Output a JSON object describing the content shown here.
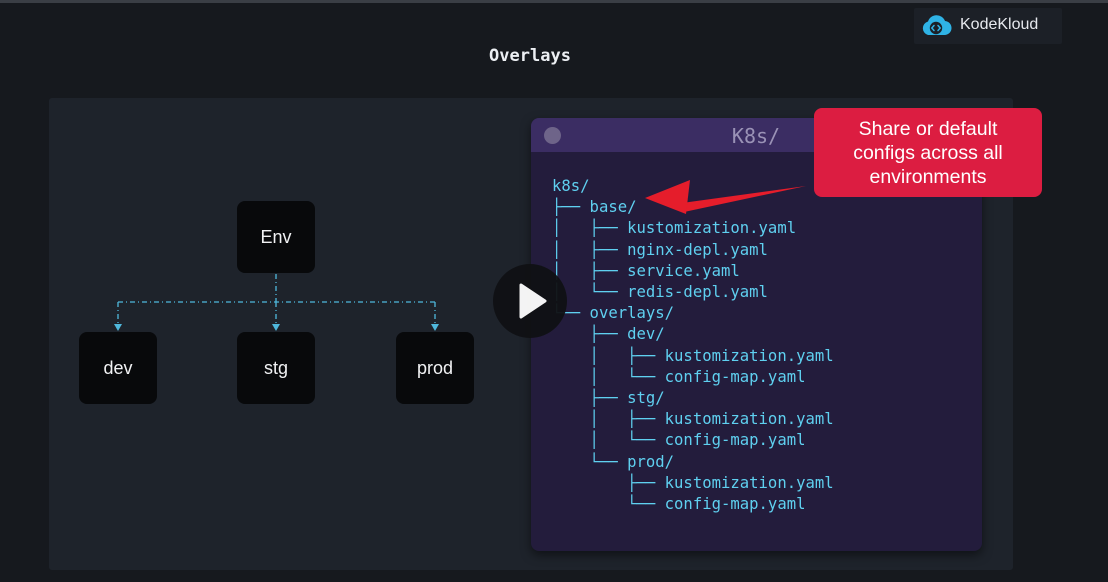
{
  "brand": {
    "name": "KodeKloud",
    "logo_icon": "cloud-code-logo-icon"
  },
  "page": {
    "title": "Overlays"
  },
  "diagram": {
    "root": "Env",
    "children": [
      "dev",
      "stg",
      "prod"
    ]
  },
  "terminal": {
    "title": "K8s/",
    "lines": [
      "k8s/",
      "├── base/",
      "│   ├── kustomization.yaml",
      "│   ├── nginx-depl.yaml",
      "│   ├── service.yaml",
      "│   └── redis-depl.yaml",
      "└── overlays/",
      "    ├── dev/",
      "    │   ├── kustomization.yaml",
      "    │   └── config-map.yaml",
      "    ├── stg/",
      "    │   ├── kustomization.yaml",
      "    │   └── config-map.yaml",
      "    └── prod/",
      "        ├── kustomization.yaml",
      "        └── config-map.yaml"
    ]
  },
  "callout": {
    "text": "Share or default configs across all environments"
  },
  "player": {
    "play_icon": "play-icon"
  },
  "colors": {
    "background": "#16191e",
    "panel": "#1e232b",
    "terminal_bg": "#231c3c",
    "terminal_bar": "#3b2d63",
    "code_text": "#5fd0f0",
    "callout_bg": "#dc1d41",
    "connector": "#4fb8dc"
  }
}
